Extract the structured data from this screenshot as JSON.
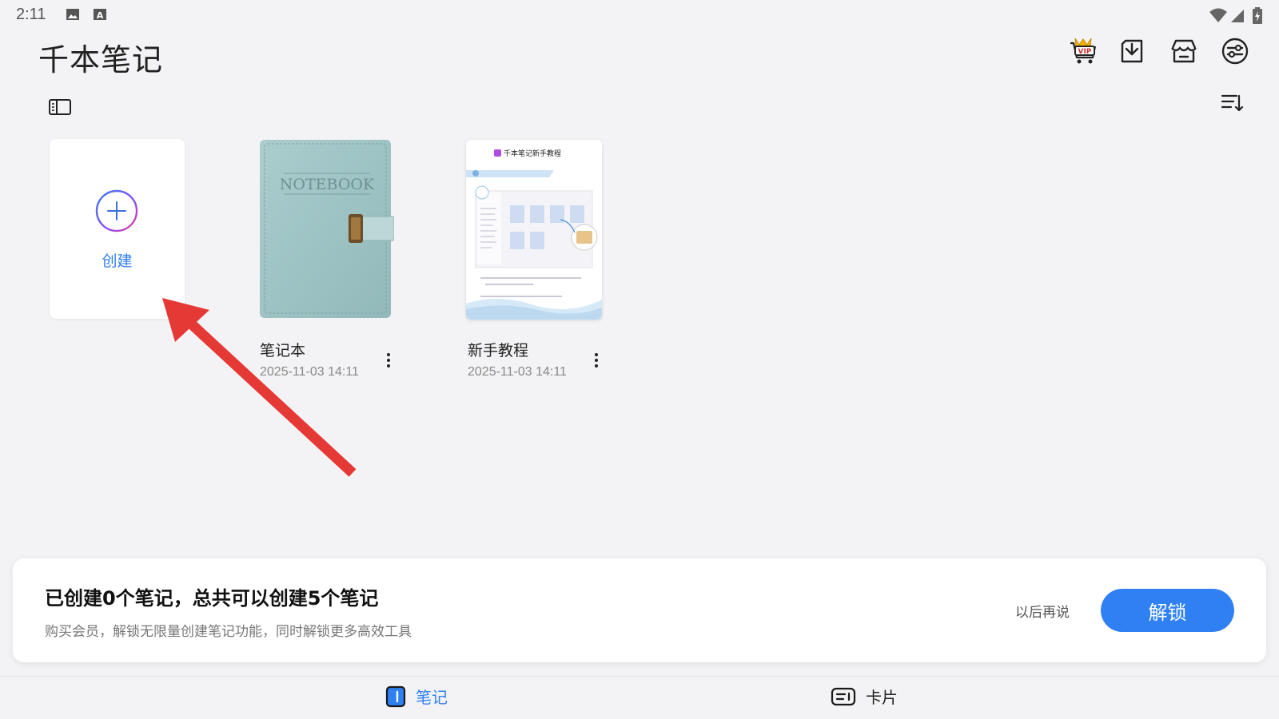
{
  "status_bar": {
    "time": "2:11"
  },
  "app": {
    "title": "千本笔记"
  },
  "toolbar": {
    "vip_icon": "vip-cart-icon",
    "import_icon": "import-icon",
    "store_icon": "store-icon",
    "settings_icon": "settings-sliders-icon"
  },
  "create_card": {
    "label": "创建"
  },
  "notebooks": [
    {
      "name": "笔记本",
      "date": "2025-11-03 14:11",
      "cover_text": "NOTEBOOK"
    },
    {
      "name": "新手教程",
      "date": "2025-11-03 14:11",
      "cover_title": "千本笔记新手教程"
    }
  ],
  "promo": {
    "title": "已创建0个笔记，总共可以创建5个笔记",
    "subtitle": "购买会员，解锁无限量创建笔记功能，同时解锁更多高效工具",
    "later_label": "以后再说",
    "unlock_label": "解锁"
  },
  "bottom_nav": {
    "tabs": [
      {
        "label": "笔记",
        "active": true
      },
      {
        "label": "卡片",
        "active": false
      }
    ]
  },
  "colors": {
    "accent": "#2f80f3",
    "arrow": "#e53935",
    "notebook": "#a7c8c8"
  }
}
